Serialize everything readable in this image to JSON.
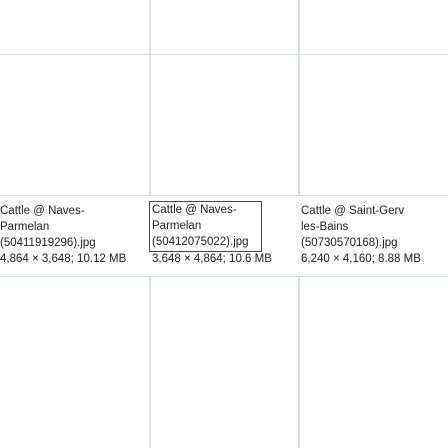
{
  "files": [
    {
      "caption_lines": [
        "Cattle @ Naves-",
        "Parmelan",
        "(50411919296).jpg"
      ],
      "meta": "4,864 × 3,648; 10.12 MB"
    },
    {
      "caption_lines": [
        "Cattle @ Naves-",
        "Parmelan",
        "(50412075022).jpg"
      ],
      "meta": "3,648 × 4,864; 10.6 MB"
    },
    {
      "caption_lines": [
        "Cattle @ Saint-Gerv",
        "les-Bains",
        "(50730570168).jpg"
      ],
      "meta": "6,240 × 4,160; 8.88 MB"
    }
  ]
}
